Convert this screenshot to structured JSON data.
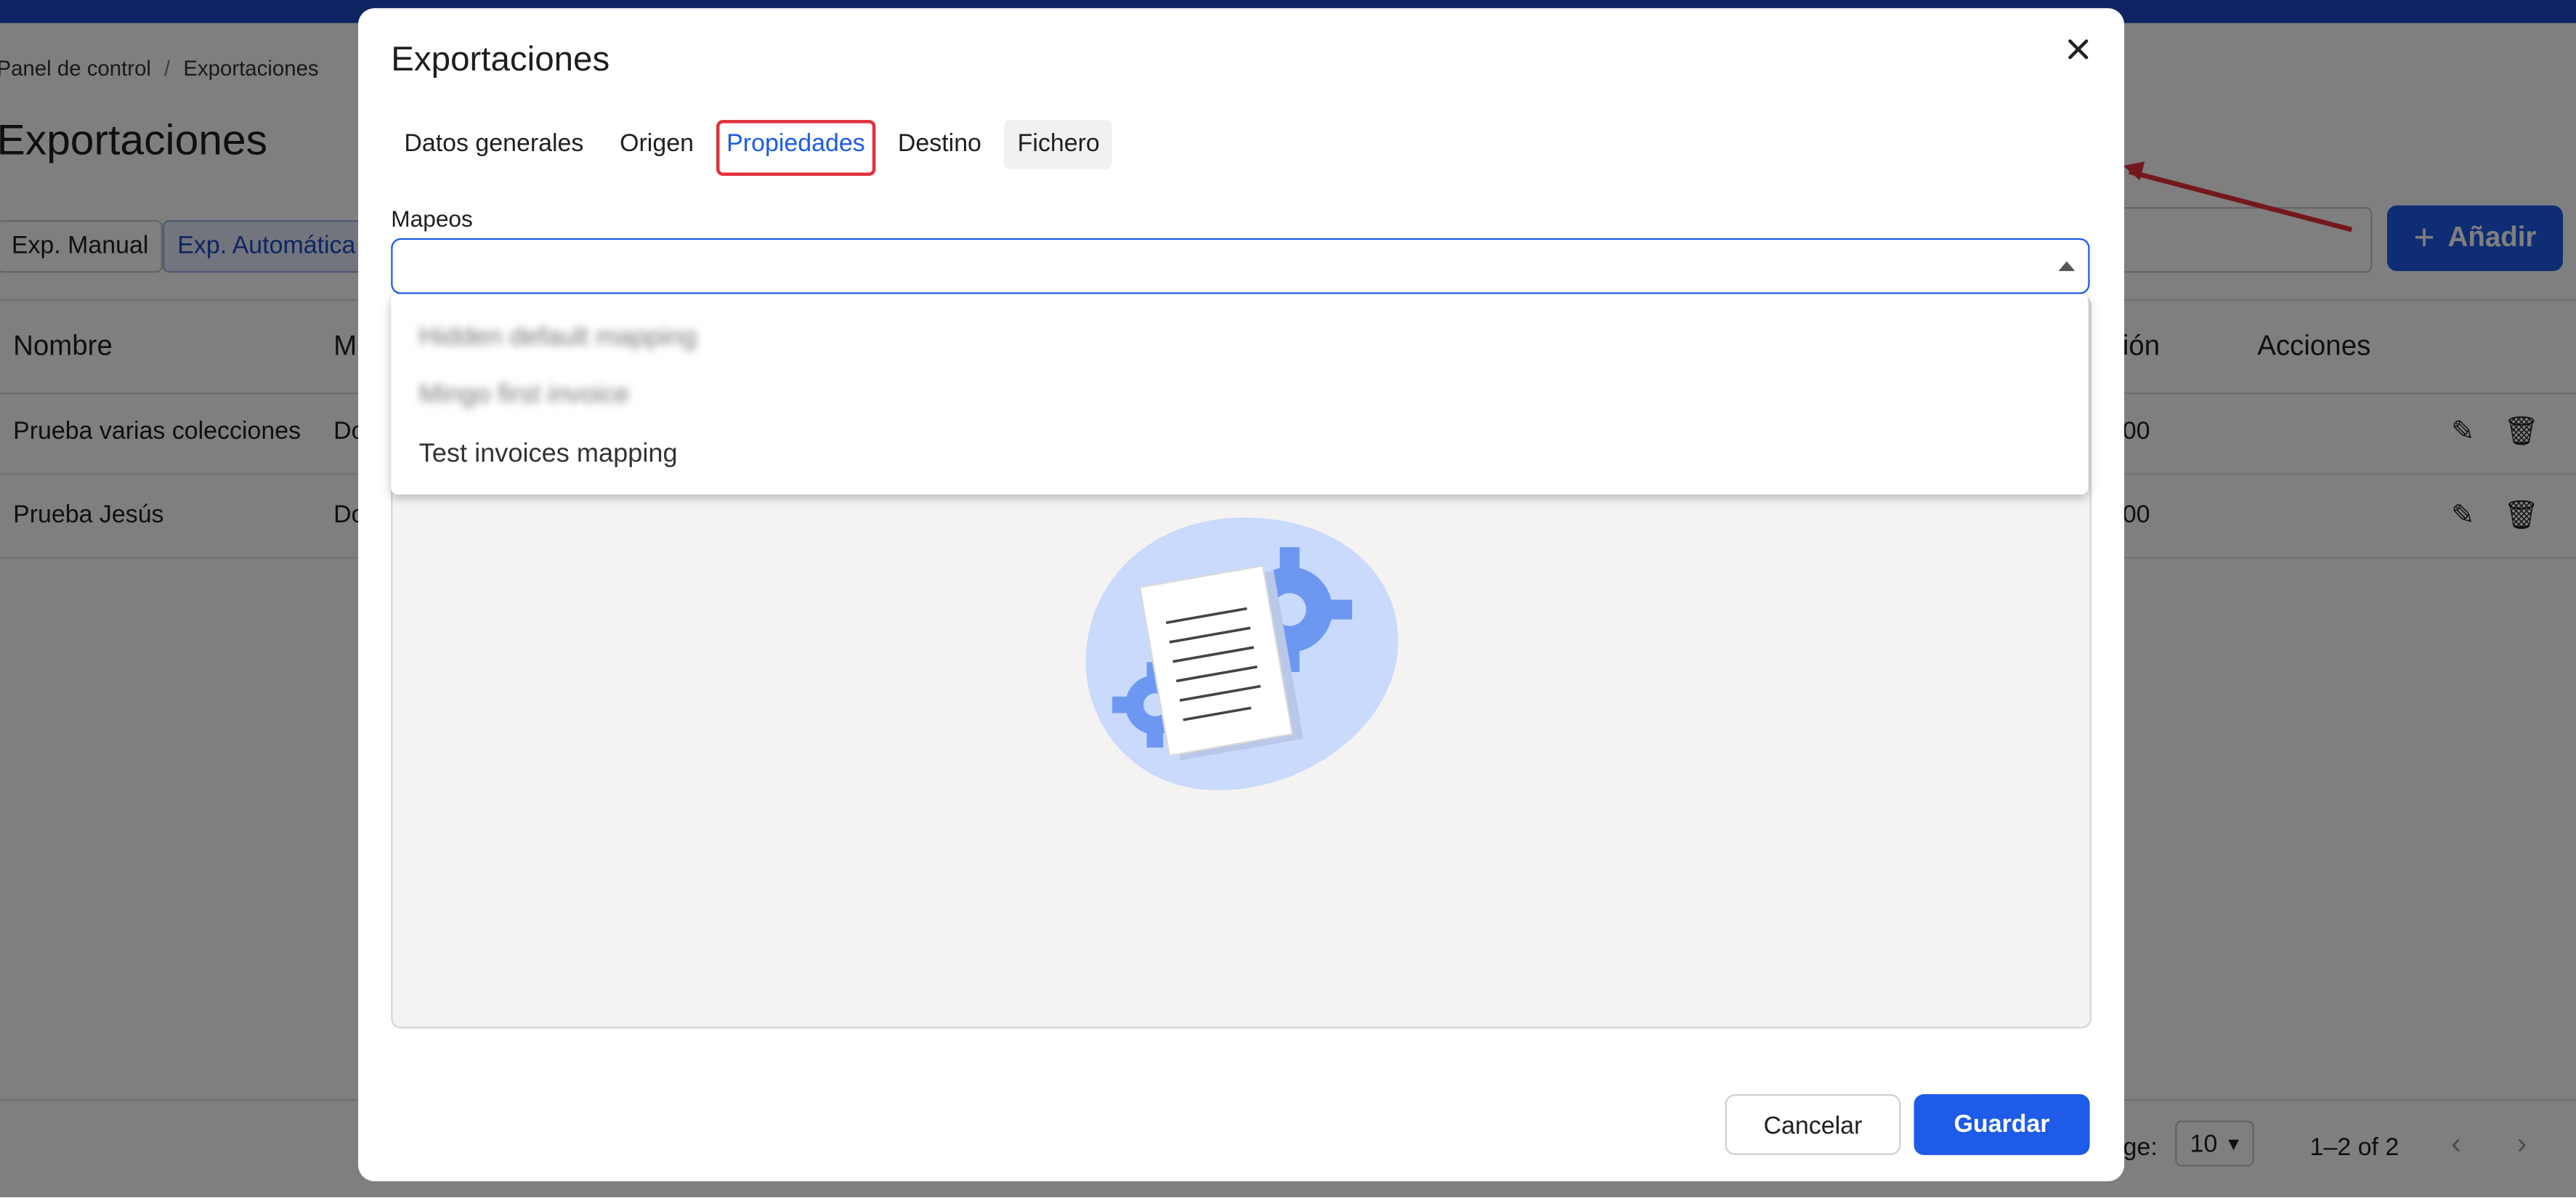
{
  "app": {
    "breadcrumb": [
      "Panel de control",
      "Exportaciones"
    ],
    "breadcrumb_sep": "/",
    "page_title": "Exportaciones",
    "segments": [
      {
        "label": "Exp. Manual",
        "active": false
      },
      {
        "label": "Exp. Automática",
        "active": true
      }
    ],
    "add_button": {
      "label": "Añadir",
      "icon": "plus-icon"
    },
    "table": {
      "columns": [
        "Nombre",
        "M",
        "ión",
        "Acciones"
      ],
      "rows": [
        {
          "name": "Prueba varias colecciones",
          "col2": "Do",
          "col3": "00"
        },
        {
          "name": "Prueba Jesús",
          "col2": "Do",
          "col3": "00"
        }
      ]
    },
    "pagination": {
      "rows_per_page_label": "age:",
      "rows_per_page_value": "10",
      "range": "1–2 of 2"
    },
    "colors": {
      "topbar": "#1d48c4",
      "accent": "#1d5be8",
      "highlight": "#e0303a"
    }
  },
  "modal": {
    "title": "Exportaciones",
    "tabs": [
      {
        "label": "Datos generales"
      },
      {
        "label": "Origen"
      },
      {
        "label": "Propiedades",
        "selected": true
      },
      {
        "label": "Destino"
      },
      {
        "label": "Fichero"
      }
    ],
    "field_label": "Mapeos",
    "field_value": "",
    "options": [
      "Hidden default mapping",
      "Mingo first invoice",
      "Test invoices mapping"
    ],
    "buttons": {
      "cancel": "Cancelar",
      "save": "Guardar"
    }
  }
}
